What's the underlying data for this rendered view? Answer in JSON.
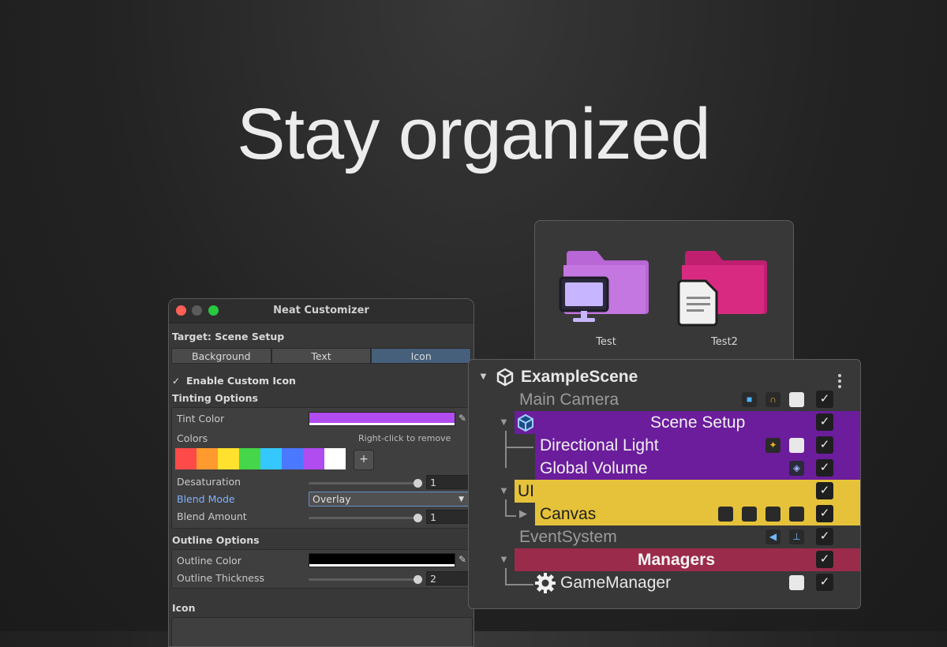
{
  "headline": "Stay organized",
  "customizer": {
    "title": "Neat Customizer",
    "target": "Target: Scene Setup",
    "tabs": [
      "Background",
      "Text",
      "Icon"
    ],
    "active_tab": "Icon",
    "enable_custom_icon": "Enable Custom Icon",
    "tinting_heading": "Tinting Options",
    "tint_color_label": "Tint Color",
    "tint_color": "#b04cf0",
    "colors_label": "Colors",
    "colors_hint": "Right-click to remove",
    "swatches": [
      "#ff4a4a",
      "#ff9a2e",
      "#ffe12e",
      "#45d64a",
      "#35c8ff",
      "#4a78ff",
      "#b04cf0",
      "#ffffff"
    ],
    "add_label": "+",
    "desaturation_label": "Desaturation",
    "desaturation_value": "1",
    "blend_mode_label": "Blend Mode",
    "blend_mode_value": "Overlay",
    "blend_amount_label": "Blend Amount",
    "blend_amount_value": "1",
    "outline_heading": "Outline Options",
    "outline_color_label": "Outline Color",
    "outline_color": "#000000",
    "outline_thickness_label": "Outline Thickness",
    "outline_thickness_value": "2",
    "icon_heading": "Icon"
  },
  "folders": [
    {
      "name": "Test",
      "color": "#b966d6",
      "badge": "monitor-icon"
    },
    {
      "name": "Test2",
      "color": "#d0267a",
      "badge": "document-icon"
    }
  ],
  "hierarchy": {
    "scene": "ExampleScene",
    "rows": [
      {
        "label": "Main Camera",
        "icons": [
          "camera-icon",
          "audio-listener-icon",
          "script-icon"
        ]
      },
      {
        "label": "Scene Setup",
        "bg": "#6b1d9c",
        "icons": []
      },
      {
        "label": "Directional Light",
        "icons": [
          "light-icon",
          "script-icon"
        ]
      },
      {
        "label": "Global Volume",
        "icons": [
          "volume-icon"
        ]
      },
      {
        "label": "UI",
        "bg": "#e5c23a",
        "icons": []
      },
      {
        "label": "Canvas",
        "icons": [
          "canvas-scaler-icon",
          "rect-icon",
          "raycaster-icon",
          "rect-transform-icon"
        ]
      },
      {
        "label": "EventSystem",
        "icons": [
          "event-system-icon",
          "input-module-icon"
        ]
      },
      {
        "label": "Managers",
        "bg": "#9b2b4a",
        "icons": []
      },
      {
        "label": "GameManager",
        "icons": [
          "script-icon"
        ]
      }
    ],
    "check": "✓"
  }
}
